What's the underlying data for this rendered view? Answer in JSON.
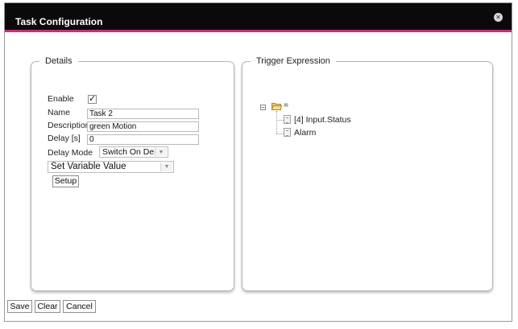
{
  "dialog": {
    "title": "Task Configuration",
    "close_glyph": "✕"
  },
  "details": {
    "legend": "Details",
    "enable_label": "Enable",
    "enable_checked": true,
    "enable_check_glyph": "✓",
    "name_label": "Name",
    "name_value": "Task 2",
    "description_label": "Description",
    "description_value": "green Motion",
    "delay_label": "Delay [s]",
    "delay_value": "0",
    "delay_mode_label": "Delay Mode",
    "delay_mode_value": "Switch On Delay",
    "action_value": "Set Variable Value",
    "setup_label": "Setup",
    "dropdown_arrow_glyph": "▼"
  },
  "trigger": {
    "legend": "Trigger Expression",
    "root_toggle_glyph": "−",
    "root_operator": "=",
    "children": [
      {
        "label": "[4] Input.Status"
      },
      {
        "label": "Alarm"
      }
    ]
  },
  "footer": {
    "save_label": "Save",
    "clear_label": "Clear",
    "cancel_label": "Cancel"
  },
  "colors": {
    "titlebar": "#0a0a0a",
    "accent": "#e0207a",
    "folder": "#f0c75a"
  },
  "icons": {
    "close": "close-icon",
    "checkbox": "checkbox-checked-icon",
    "tree_toggle": "minus-icon",
    "folder": "folder-open-icon",
    "leaf": "document-icon"
  }
}
